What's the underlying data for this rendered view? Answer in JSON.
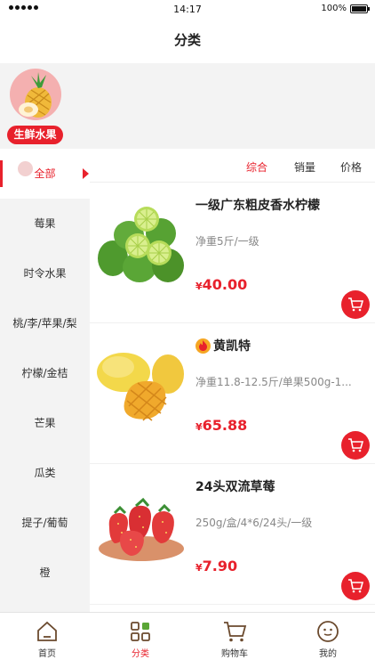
{
  "status_bar": {
    "time": "14:17",
    "battery": "100%"
  },
  "nav": {
    "title": "分类"
  },
  "category": {
    "label": "生鲜水果",
    "icon": "pineapple-icon"
  },
  "sidebar": {
    "items": [
      {
        "label": "全部",
        "active": true
      },
      {
        "label": "莓果"
      },
      {
        "label": "时令水果"
      },
      {
        "label": "桃/李/苹果/梨"
      },
      {
        "label": "柠檬/金桔"
      },
      {
        "label": "芒果"
      },
      {
        "label": "瓜类"
      },
      {
        "label": "提子/葡萄"
      },
      {
        "label": "橙"
      }
    ]
  },
  "sort": {
    "options": [
      "综合",
      "销量",
      "价格"
    ],
    "active": "综合"
  },
  "products": [
    {
      "name": "一级广东粗皮香水柠檬",
      "spec": "净重5斤/一级",
      "currency": "¥",
      "price": "40.00",
      "image": "lime-image"
    },
    {
      "name": "黄凯特",
      "badge": "flame-icon",
      "spec": "净重11.8-12.5斤/单果500g-1...",
      "currency": "¥",
      "price": "65.88",
      "image": "mango-image"
    },
    {
      "name": "24头双流草莓",
      "spec": "250g/盒/4*6/24头/一级",
      "currency": "¥",
      "price": "7.90",
      "image": "strawberry-image"
    }
  ],
  "tabbar": {
    "items": [
      {
        "label": "首页",
        "icon": "home-icon"
      },
      {
        "label": "分类",
        "icon": "category-icon",
        "active": true
      },
      {
        "label": "购物车",
        "icon": "cart-icon"
      },
      {
        "label": "我的",
        "icon": "profile-icon"
      }
    ]
  },
  "colors": {
    "accent": "#e8212c",
    "background": "#f3f3f3"
  }
}
